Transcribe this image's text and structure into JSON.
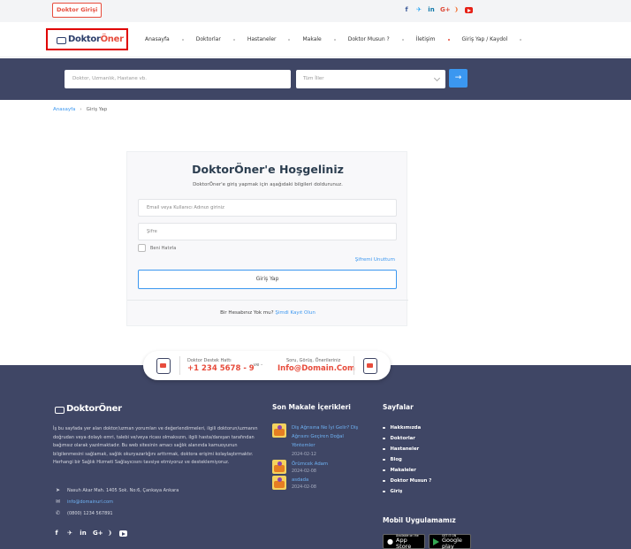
{
  "topbar": {
    "doctor_login": "Doktor Girişi",
    "social_icons": [
      "facebook-icon",
      "twitter-icon",
      "linkedin-icon",
      "google-plus-icon",
      "rss-icon",
      "youtube-icon"
    ]
  },
  "nav": {
    "logo_left": "Doktor",
    "logo_right": "Öner",
    "items": [
      "Anasayfa",
      "Doktorlar",
      "Hastaneler",
      "Makale",
      "Doktor Musun ?",
      "İletişim",
      "Giriş Yap / Kaydol"
    ]
  },
  "search": {
    "placeholder": "Doktor, Uzmanlık, Hastane vb.",
    "city_selected": "Tüm İller",
    "button_icon": "arrow-right-icon"
  },
  "breadcrumb": {
    "home": "Anasayfa",
    "separator": "›",
    "current": "Giriş Yap"
  },
  "login": {
    "title": "DoktorÖner'e Hoşgeliniz",
    "subtitle": "DoktorÖner'e giriş yapmak için aşağıdaki bilgileri doldurunuz.",
    "email_placeholder": "Email veya Kullanıcı Adınızı giriniz",
    "password_placeholder": "Şifre",
    "remember": "Beni Hatırla",
    "forgot": "Şifremi Unuttum",
    "submit": "Giriş Yap",
    "register_prompt": "Bir Hesabınız Yok mu?",
    "register_link": "Şimdi Kayıt Olun"
  },
  "support": {
    "hotline_label": "Doktor Destek Hattı",
    "hotline_value": "+1 234 5678 - 9",
    "or": "- ve -",
    "email_label": "Soru, Görüş, Önerileriniz",
    "email_value": "Info@Domain.Com"
  },
  "footer": {
    "logo": "DoktorÖner",
    "about": "İş bu sayfada yer alan doktor/uzman yorumları ve değerlendirmeleri, ilgili doktorun/uzmanın doğrudan veya dolaylı emri, talebi ve/veya ricası olmaksızın, ilgili hasta/danışan tarafından bağımsız olarak yazılmaktadır. Bu web sitesinin amacı sağlık alanında kamuoyunun bilgilenmesini sağlamak, sağlık okuryazarlığını arttırmak, doktora erişimi kolaylaştırmaktır. Herhangi bir Sağlık Hizmeti Sağlayıcısını tavsiye etmiyoruz ve desteklemiyoruz.",
    "address": "Nasuh Akar Mah. 1405 Sok. No:6, Çankaya Ankara",
    "email": "info@domainurl.com",
    "phone": "(0800) 1234 567891",
    "articles_heading": "Son Makale İçerikleri",
    "articles": [
      {
        "title_lines": [
          "Diş Ağrısına Ne İyi Gelir? Diş",
          "Ağrısını Geçiren Doğal",
          "Yöntemler"
        ],
        "date": "2024-02-12"
      },
      {
        "title_lines": [
          "Örümcek Adam"
        ],
        "date": "2024-02-08"
      },
      {
        "title_lines": [
          "asdada"
        ],
        "date": "2024-02-08"
      }
    ],
    "pages_heading": "Sayfalar",
    "pages": [
      "Hakkımızda",
      "Doktorlar",
      "Hastaneler",
      "Blog",
      "Makaleler",
      "Doktor Musun ?",
      "Giriş"
    ],
    "mobile_heading": "Mobil Uygulamamız",
    "app_store": {
      "small": "Available on the",
      "big": "App Store"
    },
    "google_play": {
      "small": "GET IT ON",
      "big": "Google play"
    }
  }
}
